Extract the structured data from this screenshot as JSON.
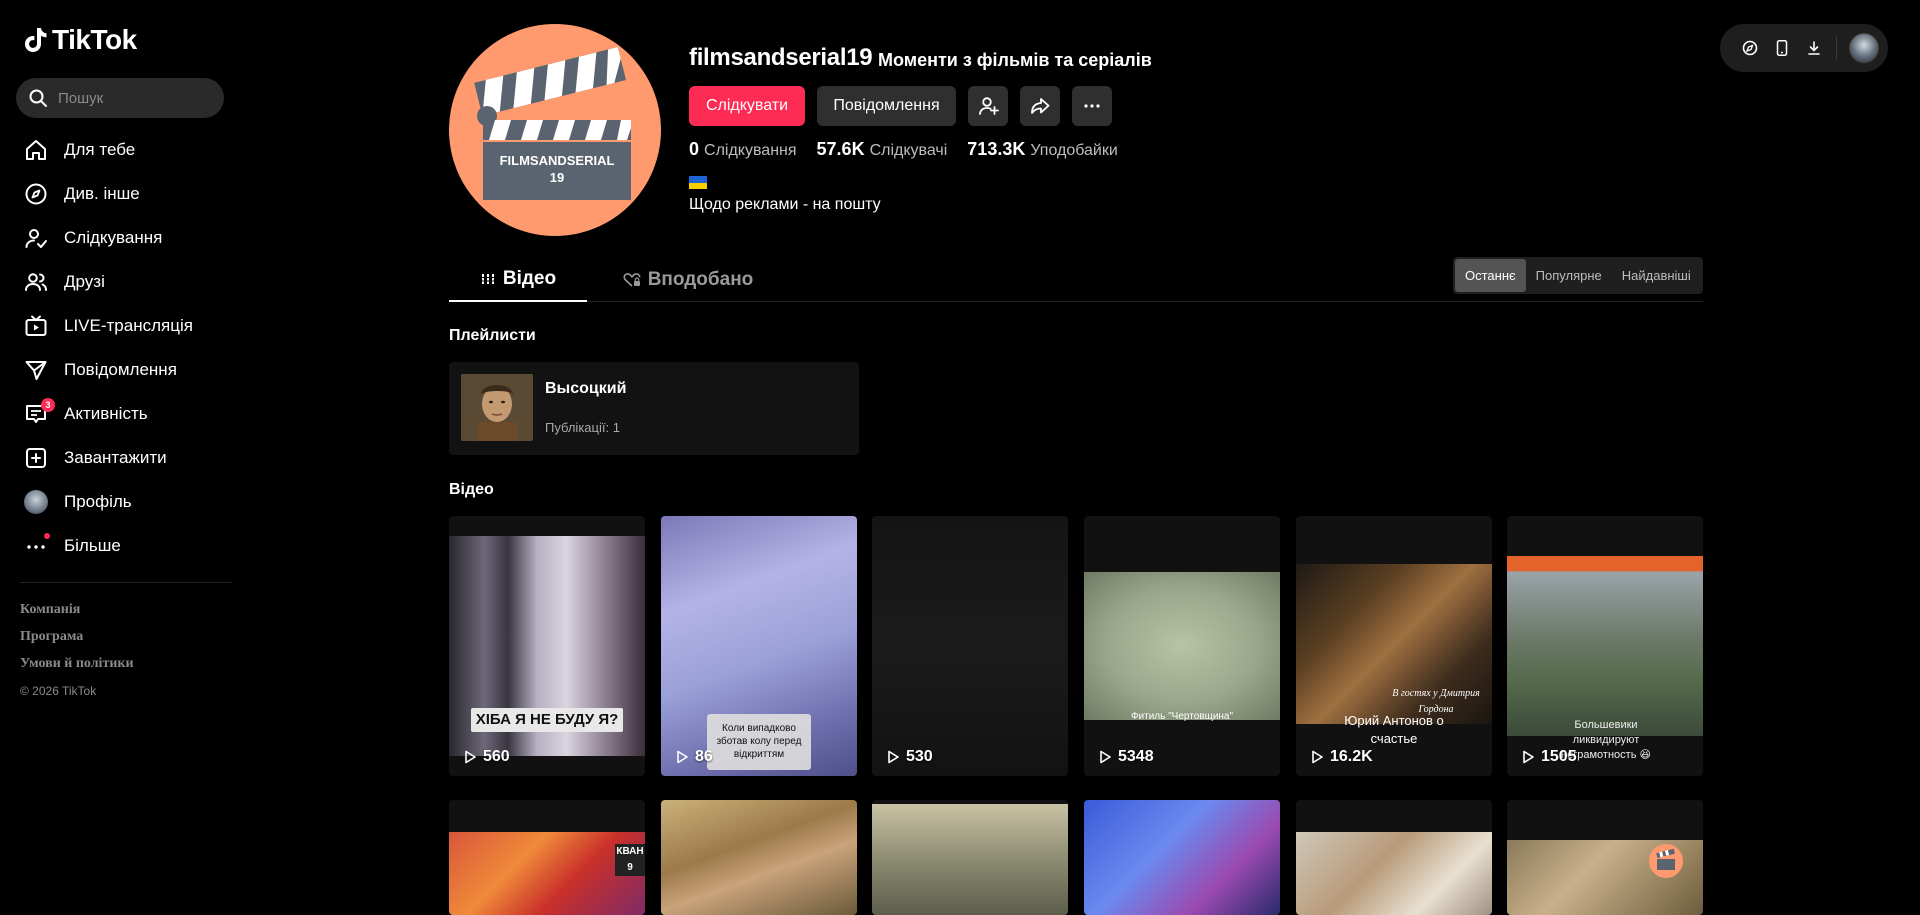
{
  "app": {
    "name": "TikTok"
  },
  "search": {
    "placeholder": "Пошук"
  },
  "nav": [
    {
      "label": "Для тебе",
      "icon": "home-icon"
    },
    {
      "label": "Див. інше",
      "icon": "compass-icon"
    },
    {
      "label": "Слідкування",
      "icon": "following-icon"
    },
    {
      "label": "Друзі",
      "icon": "friends-icon"
    },
    {
      "label": "LIVE-трансляція",
      "icon": "live-icon"
    },
    {
      "label": "Повідомлення",
      "icon": "messages-icon"
    },
    {
      "label": "Активність",
      "icon": "activity-icon",
      "badge": "3"
    },
    {
      "label": "Завантажити",
      "icon": "upload-icon"
    },
    {
      "label": "Профіль",
      "icon": "profile-avatar"
    },
    {
      "label": "Більше",
      "icon": "more-icon"
    }
  ],
  "footer": {
    "links": [
      "Компанія",
      "Програма",
      "Умови й політики"
    ],
    "copyright": "© 2026 TikTok"
  },
  "profile": {
    "username": "filmsandserial19",
    "nickname": "Моменти з фільмів та серіалів",
    "avatar_text": [
      "FILMSANDSERIAL",
      "19"
    ],
    "follow_label": "Слідкувати",
    "message_label": "Повідомлення",
    "stats": {
      "following": {
        "value": "0",
        "label": "Слідкування"
      },
      "followers": {
        "value": "57.6K",
        "label": "Слідкувачі"
      },
      "likes": {
        "value": "713.3K",
        "label": "Уподобайки"
      }
    },
    "bio": "Щодо реклами - на пошту"
  },
  "tabs": {
    "videos": "Відео",
    "liked": "Вподобано"
  },
  "sort": {
    "latest": "Останнє",
    "popular": "Популярне",
    "oldest": "Найдавніші"
  },
  "playlists": {
    "title": "Плейлисти",
    "items": [
      {
        "name": "Высоцкий",
        "count": "Публікації: 1"
      }
    ]
  },
  "videos": {
    "title": "Відео",
    "row1": [
      {
        "views": "560",
        "caption": "ХІБА Я НЕ БУДУ Я?"
      },
      {
        "views": "86",
        "caption": "Коли випадково зботав колу перед відкриттям"
      },
      {
        "views": "530",
        "caption": ""
      },
      {
        "views": "5348",
        "caption": "Фитиль \"Чертовщина\""
      },
      {
        "views": "16.2K",
        "caption": "Юрий Антонов о счастье",
        "overlay": "В гостях у Дмитрия Гордона"
      },
      {
        "views": "1505",
        "caption": "Большевики ликвидируют неграмотность 😆"
      }
    ],
    "row2_overlay": "КВАН 9"
  },
  "colors": {
    "accent": "#fe2c55",
    "background": "#000000",
    "avatar_bg": "#ff9a6e"
  }
}
